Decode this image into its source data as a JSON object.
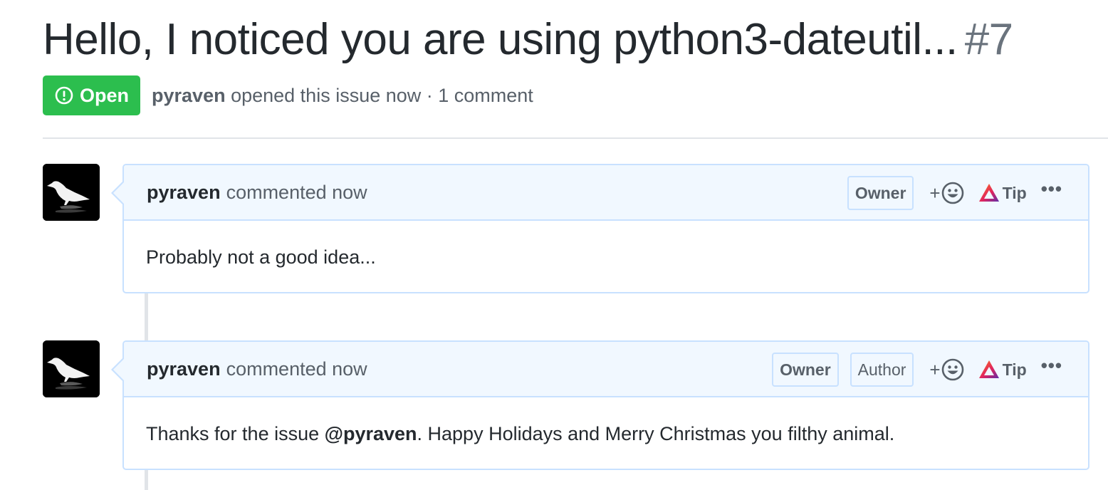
{
  "issue": {
    "title": "Hello, I noticed you are using python3-dateutil...",
    "number": "#7",
    "state": "Open",
    "author": "pyraven",
    "opened_text": " opened this issue now · 1 comment"
  },
  "comments": [
    {
      "author": "pyraven",
      "action": "commented now",
      "badges": [
        "Owner"
      ],
      "reaction_plus": "+",
      "tip_label": "Tip",
      "more": "•••",
      "body": "Probably not a good idea..."
    },
    {
      "author": "pyraven",
      "action": "commented now",
      "badges": [
        "Owner",
        "Author"
      ],
      "reaction_plus": "+",
      "tip_label": "Tip",
      "more": "•••",
      "body_before": "Thanks for the issue ",
      "mention": "@pyraven",
      "body_after": ". Happy Holidays and Merry Christmas you filthy animal."
    }
  ],
  "colors": {
    "open_green": "#2cbe4e",
    "header_bg": "#f1f8ff",
    "border_blue": "#c8e1ff",
    "text_muted": "#586069"
  },
  "icons": [
    "issue-opened-icon",
    "avatar-raven",
    "smiley-icon",
    "brave-tip-icon",
    "kebab-icon"
  ]
}
